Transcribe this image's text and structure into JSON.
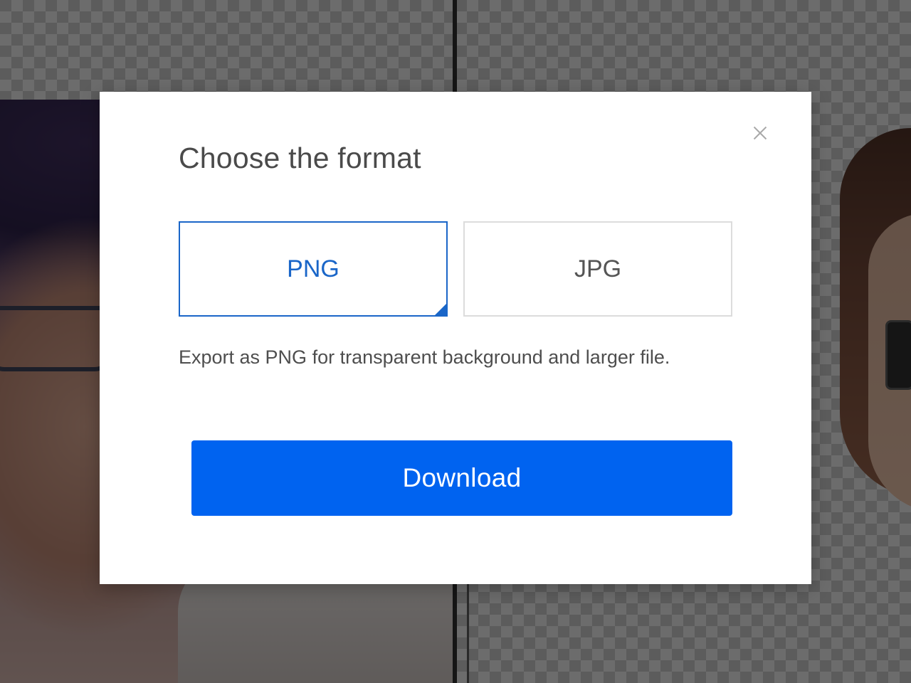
{
  "dialog": {
    "title": "Choose the format",
    "close_icon": "close-icon",
    "formats": [
      {
        "label": "PNG",
        "selected": true
      },
      {
        "label": "JPG",
        "selected": false
      }
    ],
    "description": "Export as PNG for transparent background and larger file.",
    "download_label": "Download"
  },
  "colors": {
    "accent": "#0063f0",
    "selected_border": "#1a66c8",
    "unselected_border": "#dcdcdc",
    "title_text": "#4a4a4a",
    "overlay": "rgba(0,0,0,0.5)"
  }
}
